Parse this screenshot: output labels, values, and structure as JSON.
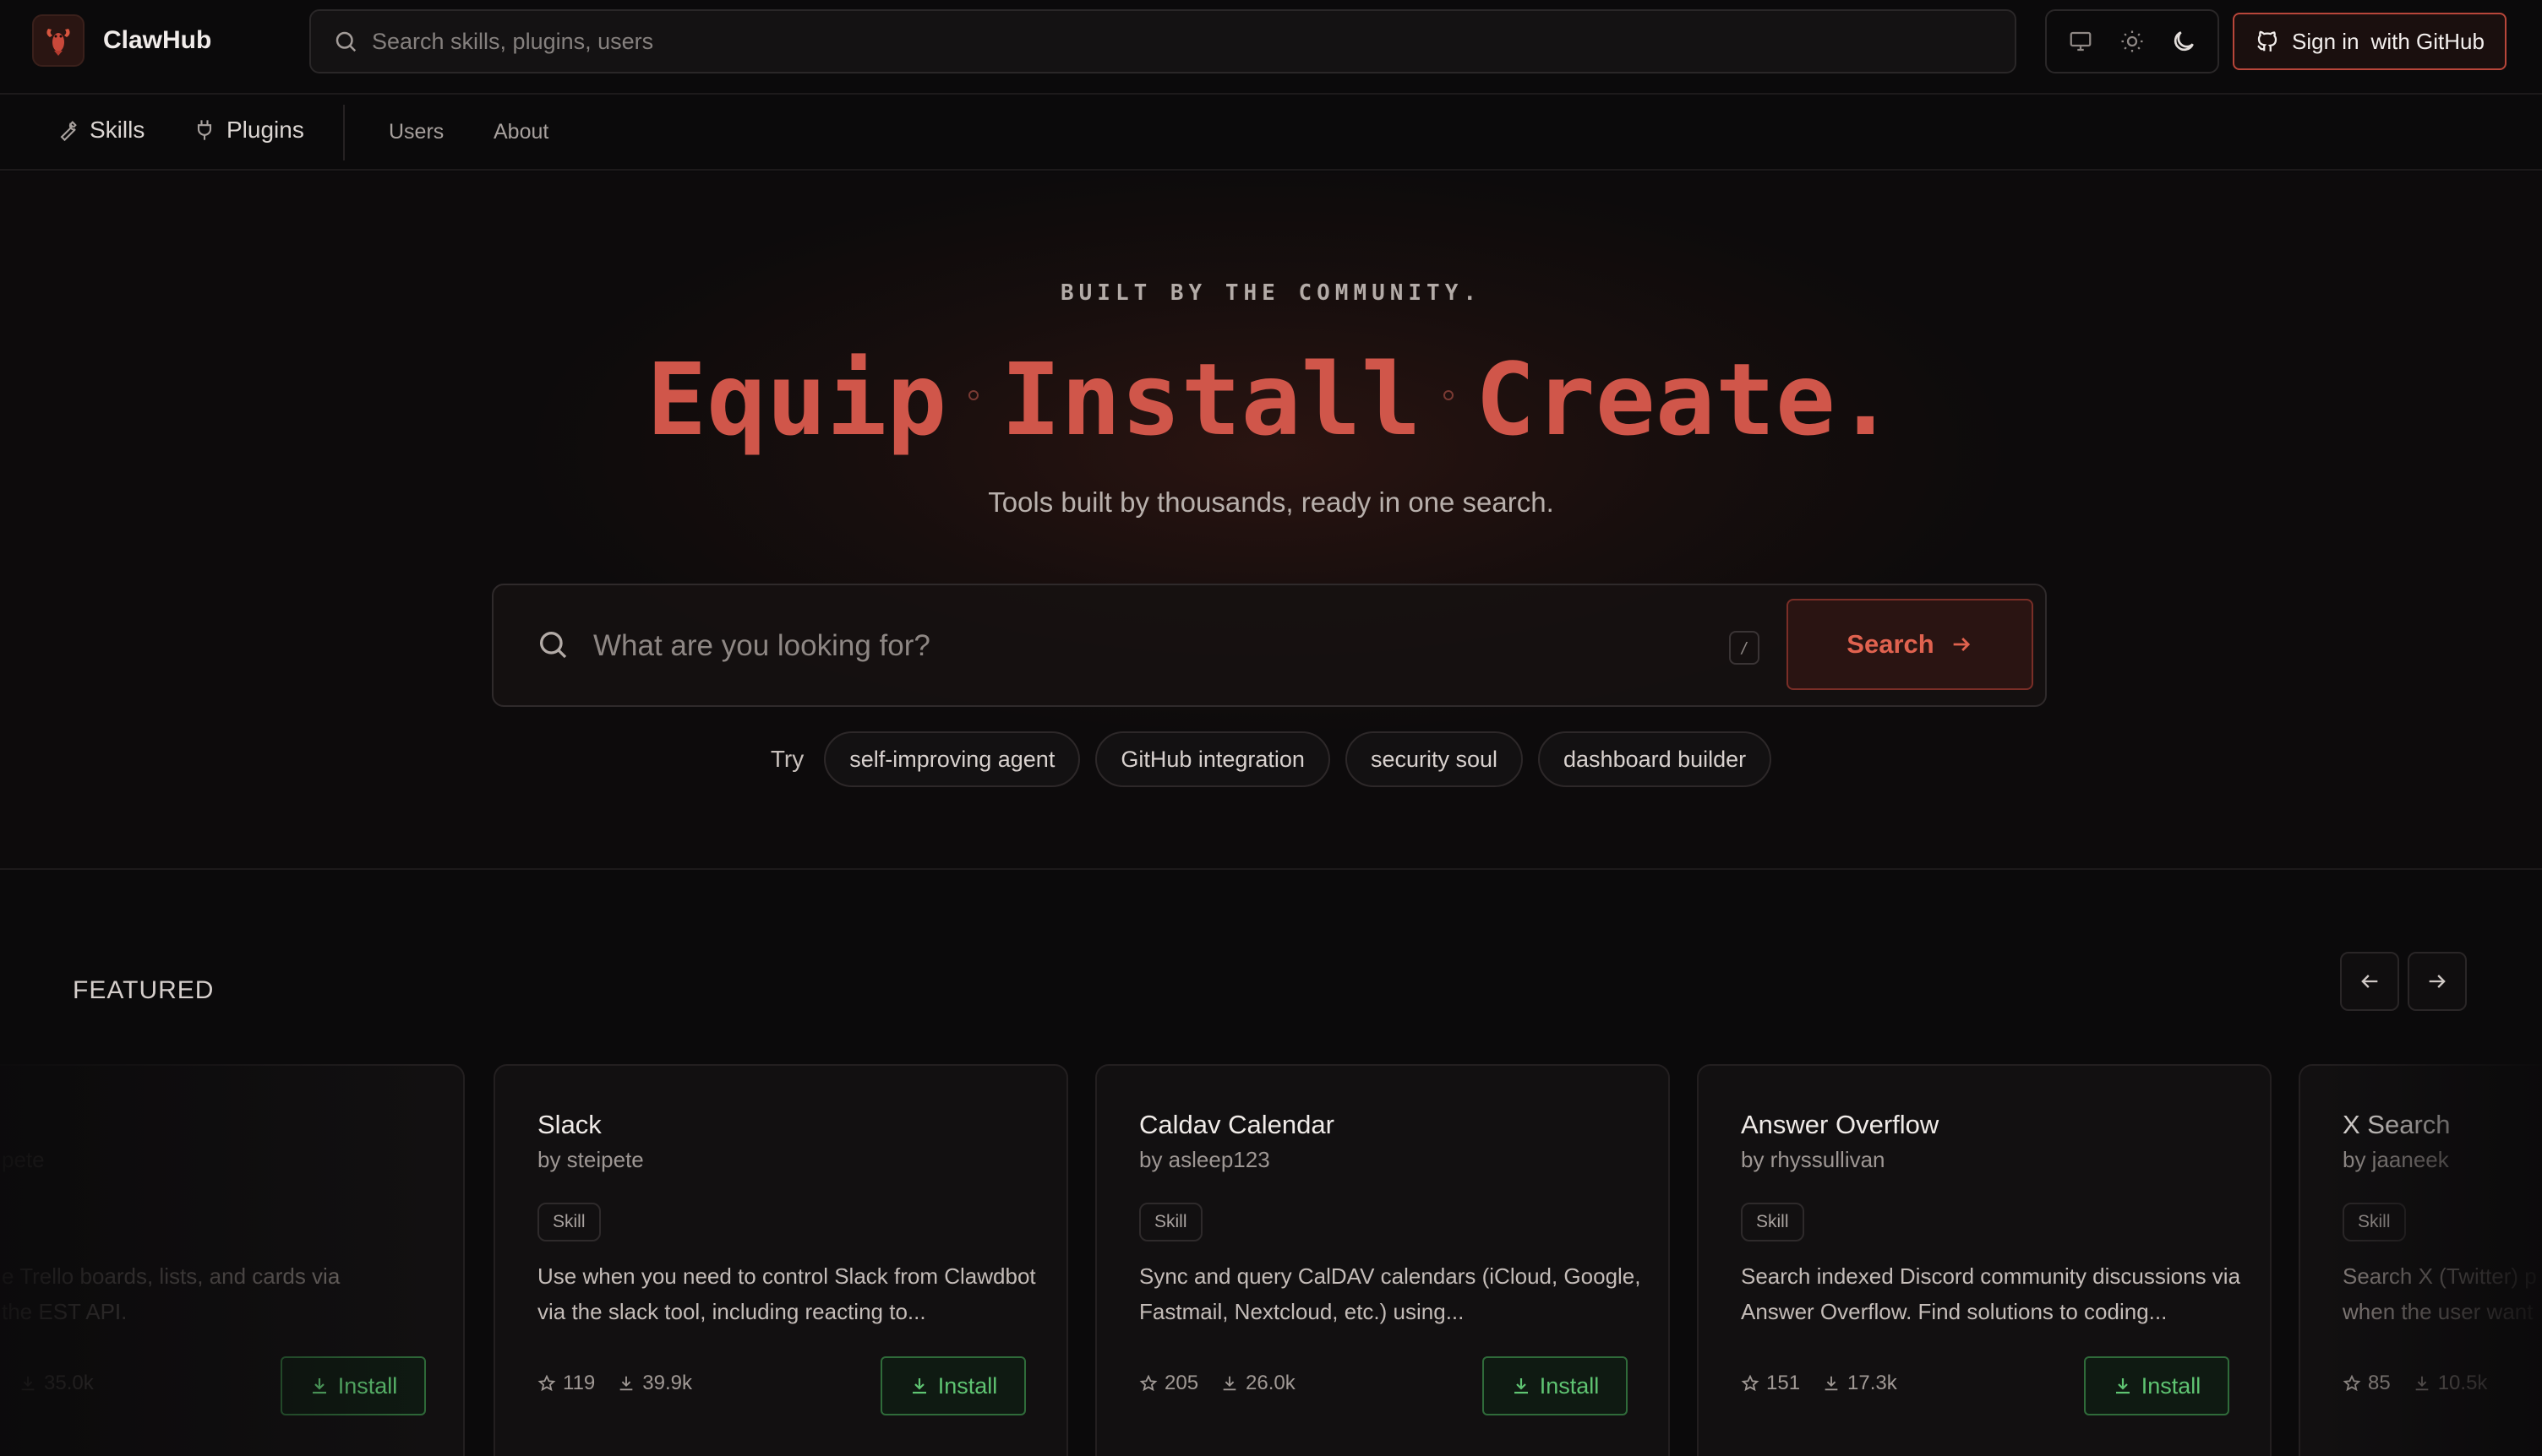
{
  "header": {
    "brand_name": "ClawHub",
    "search_placeholder": "Search skills, plugins, users",
    "signin_label": "Sign in",
    "signin_with": "with GitHub"
  },
  "nav": {
    "skills": "Skills",
    "plugins": "Plugins",
    "users": "Users",
    "about": "About"
  },
  "hero": {
    "eyebrow": "BUILT BY THE COMMUNITY.",
    "words": [
      "Equip",
      "Install",
      "Create."
    ],
    "tagline": "Tools built by thousands, ready in one search.",
    "search_placeholder": "What are you looking for?",
    "shortcut": "/",
    "search_button": "Search",
    "try_label": "Try",
    "suggestions": [
      "self-improving agent",
      "GitHub integration",
      "security soul",
      "dashboard builder"
    ]
  },
  "featured": {
    "label": "FEATURED",
    "cards": [
      {
        "title": "",
        "author": "pete",
        "badge": "",
        "desc": "e Trello boards, lists, and cards via the EST API.",
        "stars": "",
        "downloads": "35.0k",
        "install": "Install"
      },
      {
        "title": "Slack",
        "author": "by steipete",
        "badge": "Skill",
        "desc": "Use when you need to control Slack from Clawdbot via the slack tool, including reacting to...",
        "stars": "119",
        "downloads": "39.9k",
        "install": "Install"
      },
      {
        "title": "Caldav Calendar",
        "author": "by asleep123",
        "badge": "Skill",
        "desc": "Sync and query CalDAV calendars (iCloud, Google, Fastmail, Nextcloud, etc.) using...",
        "stars": "205",
        "downloads": "26.0k",
        "install": "Install"
      },
      {
        "title": "Answer Overflow",
        "author": "by rhyssullivan",
        "badge": "Skill",
        "desc": "Search indexed Discord community discussions via Answer Overflow. Find solutions to coding...",
        "stars": "151",
        "downloads": "17.3k",
        "install": "Install"
      },
      {
        "title": "X Search",
        "author": "by jaaneek",
        "badge": "Skill",
        "desc": "Search X (Twitter) p when the user want",
        "stars": "85",
        "downloads": "10.5k",
        "install": ""
      }
    ]
  },
  "colors": {
    "accent": "#d0564a",
    "install_green": "#5fc472",
    "background": "#0b0a0b"
  },
  "icons": {
    "theme": [
      "monitor-icon",
      "sun-icon",
      "moon-icon"
    ],
    "nav": [
      "wrench-icon",
      "plug-icon"
    ]
  }
}
